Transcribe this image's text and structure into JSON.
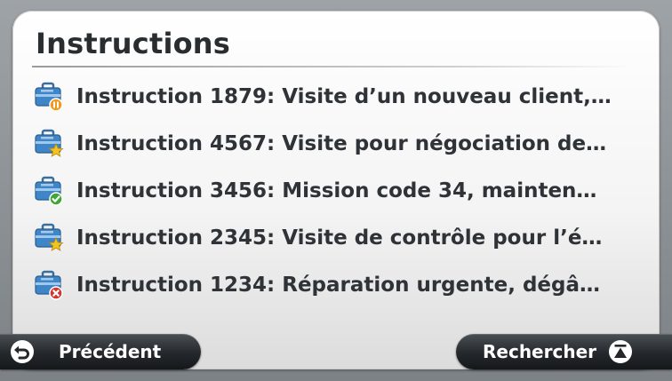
{
  "header": {
    "title": "Instructions"
  },
  "instructions": [
    {
      "label": "Instruction 1879: Visite d’un nouveau client,…",
      "icon": "briefcase-pending-icon",
      "badge_color": "#f29a1b"
    },
    {
      "label": "Instruction 4567: Visite pour négociation de…",
      "icon": "briefcase-star-icon",
      "badge_color": "#f6c21c"
    },
    {
      "label": "Instruction 3456: Mission code 34, mainten…",
      "icon": "briefcase-check-icon",
      "badge_color": "#3fa535"
    },
    {
      "label": "Instruction 2345: Visite de contrôle pour l’é…",
      "icon": "briefcase-star-icon",
      "badge_color": "#f6c21c"
    },
    {
      "label": "Instruction 1234: Réparation urgente, dégâ…",
      "icon": "briefcase-reject-icon",
      "badge_color": "#d8322b"
    }
  ],
  "footer": {
    "back_label": "Précédent",
    "search_label": "Rechercher"
  },
  "colors": {
    "briefcase_blue": "#3f86c9",
    "button_dark": "#24282c"
  }
}
